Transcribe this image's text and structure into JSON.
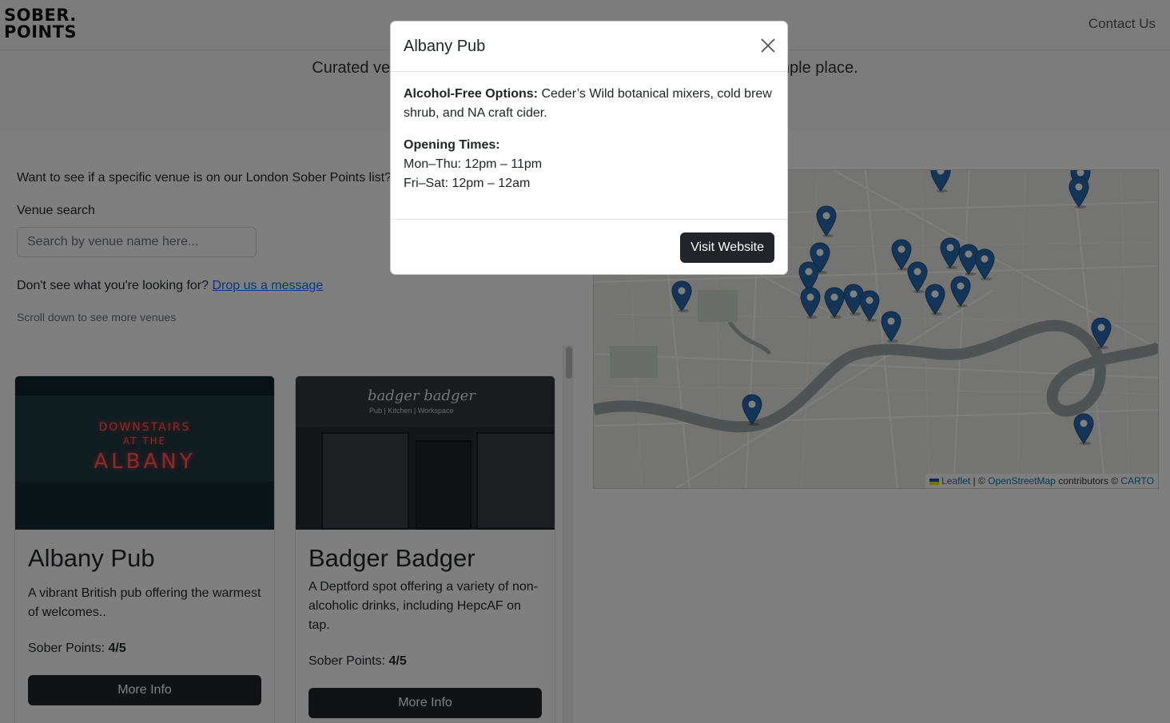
{
  "brand": {
    "line1": "SOBER.",
    "line2": "POINTS"
  },
  "nav": {
    "contact": "Contact Us"
  },
  "hero": {
    "tagline": "Curated venues offering the best alcohol-free options, all in one simple place."
  },
  "search": {
    "intro": "Want to see if a specific venue is on our London Sober Points list?",
    "label": "Venue search",
    "placeholder": "Search by venue name here...",
    "message_prefix": "Don't see what you're looking for?",
    "message_link": "Drop us a message",
    "scroll_hint": "Scroll down to see more venues"
  },
  "venues": [
    {
      "name": "Albany Pub",
      "description": "A vibrant British pub offering the warmest of welcomes..",
      "points_label": "Sober Points:",
      "points": "4/5",
      "button": "More Info",
      "image_text": [
        "DOWNSTAIRS",
        "AT THE",
        "ALBANY"
      ]
    },
    {
      "name": "Badger Badger",
      "description": "A Deptford spot offering a variety of non-alcoholic drinks, including HepcAF on tap.",
      "points_label": "Sober Points:",
      "points": "4/5",
      "button": "More Info",
      "image_text": [
        "badger badger",
        "Pub | Kitchen | Workspace"
      ]
    }
  ],
  "map": {
    "attribution": {
      "leaflet": "Leaflet",
      "sep": "| ©",
      "osm": "OpenStreetMap",
      "contributors": "contributors ©",
      "carto": "CARTO"
    },
    "marker_color": "#2a6bb0"
  },
  "modal": {
    "title": "Albany Pub",
    "options_label": "Alcohol-Free Options:",
    "options_text": "Ceder’s Wild botanical mixers, cold brew shrub, and NA craft cider.",
    "hours_label": "Opening Times:",
    "hours": [
      "Mon–Thu: 12pm – 11pm",
      "Fri–Sat: 12pm – 12am"
    ],
    "button": "Visit Website"
  }
}
